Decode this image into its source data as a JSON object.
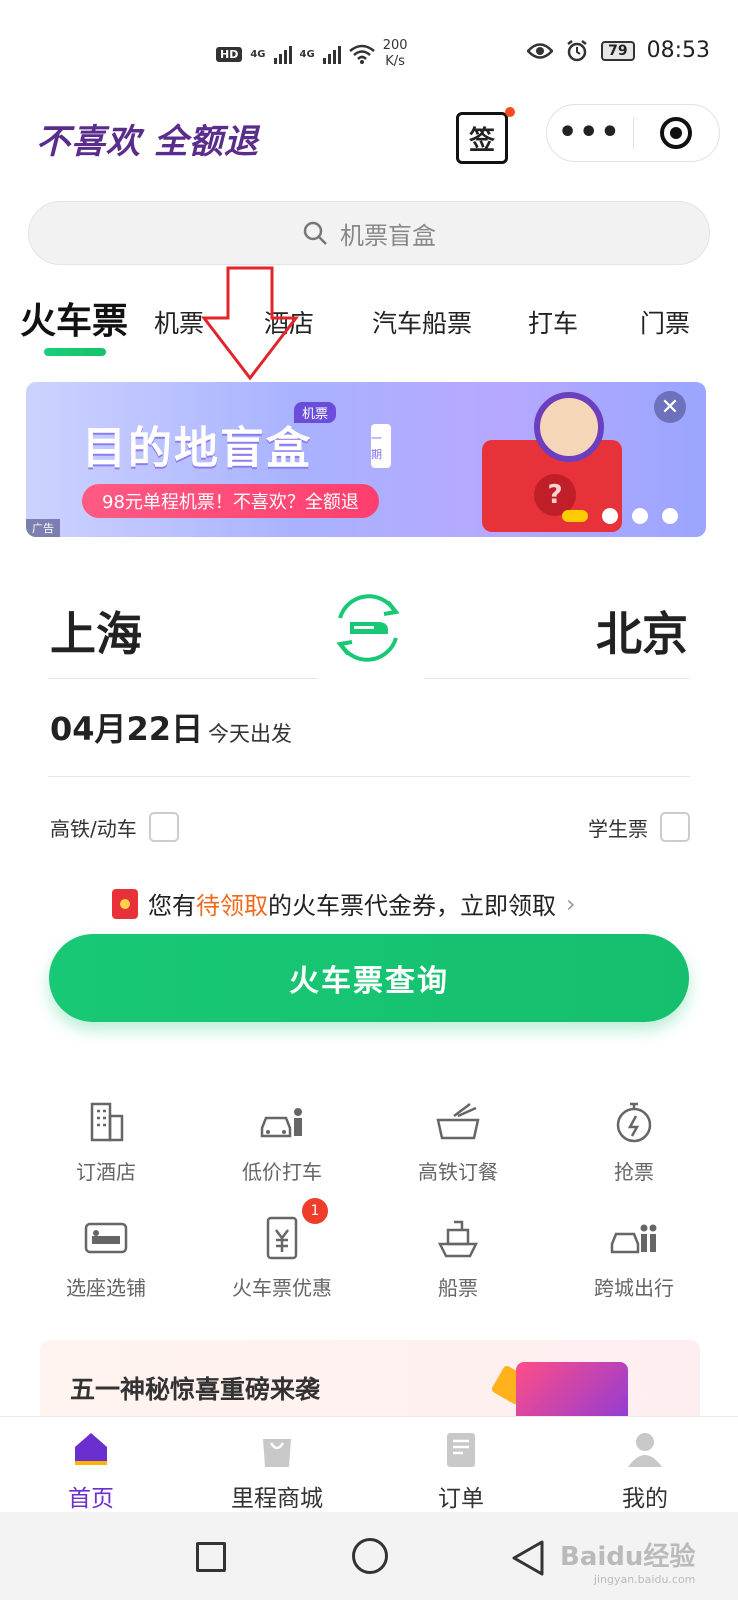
{
  "status_bar": {
    "hd": "HD",
    "net1": "4G",
    "net2": "4G",
    "speed_value": "200",
    "speed_unit": "K/s",
    "battery": "79",
    "time": "08:53"
  },
  "header": {
    "brand": "不喜欢 全额退",
    "sign_label": "签",
    "more_label": "•••"
  },
  "search": {
    "placeholder": "机票盲盒"
  },
  "tabs": [
    {
      "label": "火车票"
    },
    {
      "label": "机票"
    },
    {
      "label": "酒店"
    },
    {
      "label": "汽车船票"
    },
    {
      "label": "打车"
    },
    {
      "label": "门票"
    }
  ],
  "banner": {
    "tag": "机票",
    "title": "目的地盲盒",
    "issue": "一期",
    "subtitle": "98元单程机票！不喜欢？全额退",
    "ad_label": "广告",
    "close": "✕",
    "box_mark": "?"
  },
  "route": {
    "from": "上海",
    "to": "北京",
    "date": "04月22日",
    "date_hint": "今天出发"
  },
  "options": {
    "high_speed": "高铁/动车",
    "student": "学生票"
  },
  "coupon": {
    "prefix": "您有",
    "highlight": "待领取",
    "suffix": "的火车票代金券，立即领取",
    "chevron": "›"
  },
  "query_button": "火车票查询",
  "services": [
    {
      "label": "订酒店",
      "icon": "hotel-icon"
    },
    {
      "label": "低价打车",
      "icon": "taxi-icon"
    },
    {
      "label": "高铁订餐",
      "icon": "meal-icon"
    },
    {
      "label": "抢票",
      "icon": "stopwatch-icon"
    },
    {
      "label": "选座选铺",
      "icon": "seat-icon"
    },
    {
      "label": "火车票优惠",
      "icon": "coupon-icon",
      "badge": "1"
    },
    {
      "label": "船票",
      "icon": "ship-icon"
    },
    {
      "label": "跨城出行",
      "icon": "intercity-icon"
    }
  ],
  "promo": {
    "title": "五一神秘惊喜重磅来袭"
  },
  "tab_bar": [
    {
      "label": "首页",
      "icon": "home-icon",
      "active": true
    },
    {
      "label": "里程商城",
      "icon": "shopping-bag-icon"
    },
    {
      "label": "订单",
      "icon": "order-icon"
    },
    {
      "label": "我的",
      "icon": "profile-icon"
    }
  ],
  "watermark": {
    "text": "Baidu经验",
    "sub": "jingyan.baidu.com"
  },
  "colors": {
    "accent": "#18c874",
    "brand_purple": "#5a2d8c",
    "highlight_orange": "#f06a1e",
    "active_tab_purple": "#6c2fcf"
  }
}
